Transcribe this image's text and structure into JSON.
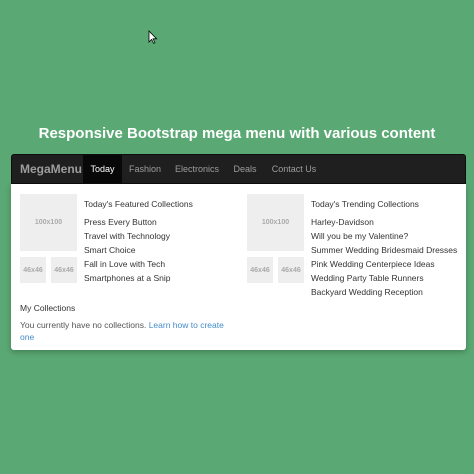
{
  "page": {
    "title": "Responsive Bootstrap mega menu with various content",
    "background_color": "#5aa873"
  },
  "navbar": {
    "brand": "MegaMenu",
    "items": [
      {
        "label": "Today",
        "active": true
      },
      {
        "label": "Fashion",
        "active": false
      },
      {
        "label": "Electronics",
        "active": false
      },
      {
        "label": "Deals",
        "active": false
      },
      {
        "label": "Contact Us",
        "active": false
      }
    ]
  },
  "mega_menu": {
    "featured": {
      "heading": "Today's Featured Collections",
      "big_image_label": "100x100",
      "small_image_labels": [
        "46x46",
        "46x46"
      ],
      "links": [
        "Press Every Button",
        "Travel with Technology",
        "Smart Choice",
        "Fall in Love with Tech",
        "Smartphones at a Snip"
      ]
    },
    "trending": {
      "heading": "Today's Trending Collections",
      "big_image_label": "100x100",
      "small_image_labels": [
        "46x46",
        "46x46"
      ],
      "links": [
        "Harley-Davidson",
        "Will you be my Valentine?",
        "Summer Wedding Bridesmaid Dresses",
        "Pink Wedding Centerpiece Ideas",
        "Wedding Party Table Runners",
        "Backyard Wedding Reception"
      ]
    },
    "my_collections": {
      "heading": "My Collections",
      "text": "You currently have no collections.",
      "link_text": "Learn how to create one"
    }
  },
  "colors": {
    "navbar_bg": "#1f1f1f",
    "active_bg": "#080808",
    "link_blue": "#428bca"
  },
  "icons": {
    "cursor": "mouse-pointer-icon"
  }
}
